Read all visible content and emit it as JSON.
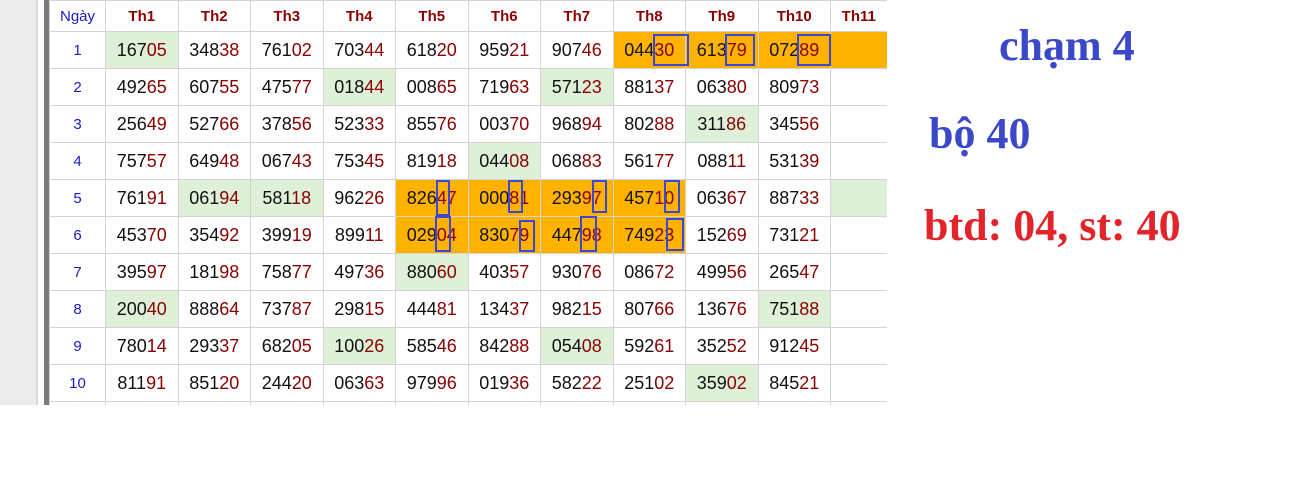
{
  "table": {
    "columns": [
      "Ngày",
      "Th1",
      "Th2",
      "Th3",
      "Th4",
      "Th5",
      "Th6",
      "Th7",
      "Th8",
      "Th9",
      "Th10",
      "Th11"
    ],
    "rows": [
      {
        "day": "1",
        "cells": [
          [
            "167",
            "05"
          ],
          [
            "348",
            "38"
          ],
          [
            "761",
            "02"
          ],
          [
            "703",
            "44"
          ],
          [
            "618",
            "20"
          ],
          [
            "959",
            "21"
          ],
          [
            "907",
            "46"
          ],
          [
            "044",
            "30"
          ],
          [
            "613",
            "79"
          ],
          [
            "072",
            "89"
          ],
          [
            "",
            ""
          ]
        ]
      },
      {
        "day": "2",
        "cells": [
          [
            "492",
            "65"
          ],
          [
            "607",
            "55"
          ],
          [
            "475",
            "77"
          ],
          [
            "018",
            "44"
          ],
          [
            "008",
            "65"
          ],
          [
            "719",
            "63"
          ],
          [
            "571",
            "23"
          ],
          [
            "881",
            "37"
          ],
          [
            "063",
            "80"
          ],
          [
            "809",
            "73"
          ],
          [
            "",
            ""
          ]
        ]
      },
      {
        "day": "3",
        "cells": [
          [
            "256",
            "49"
          ],
          [
            "527",
            "66"
          ],
          [
            "378",
            "56"
          ],
          [
            "523",
            "33"
          ],
          [
            "855",
            "76"
          ],
          [
            "003",
            "70"
          ],
          [
            "968",
            "94"
          ],
          [
            "802",
            "88"
          ],
          [
            "311",
            "86"
          ],
          [
            "345",
            "56"
          ],
          [
            "",
            ""
          ]
        ]
      },
      {
        "day": "4",
        "cells": [
          [
            "757",
            "57"
          ],
          [
            "649",
            "48"
          ],
          [
            "067",
            "43"
          ],
          [
            "753",
            "45"
          ],
          [
            "819",
            "18"
          ],
          [
            "044",
            "08"
          ],
          [
            "068",
            "83"
          ],
          [
            "561",
            "77"
          ],
          [
            "088",
            "11"
          ],
          [
            "531",
            "39"
          ],
          [
            "",
            ""
          ]
        ]
      },
      {
        "day": "5",
        "cells": [
          [
            "761",
            "91"
          ],
          [
            "061",
            "94"
          ],
          [
            "581",
            "18"
          ],
          [
            "962",
            "26"
          ],
          [
            "826",
            "47"
          ],
          [
            "000",
            "81"
          ],
          [
            "293",
            "97"
          ],
          [
            "457",
            "10"
          ],
          [
            "063",
            "67"
          ],
          [
            "887",
            "33"
          ],
          [
            "",
            ""
          ]
        ]
      },
      {
        "day": "6",
        "cells": [
          [
            "453",
            "70"
          ],
          [
            "354",
            "92"
          ],
          [
            "399",
            "19"
          ],
          [
            "899",
            "11"
          ],
          [
            "029",
            "04"
          ],
          [
            "830",
            "79"
          ],
          [
            "447",
            "98"
          ],
          [
            "749",
            "23"
          ],
          [
            "152",
            "69"
          ],
          [
            "731",
            "21"
          ],
          [
            "",
            ""
          ]
        ]
      },
      {
        "day": "7",
        "cells": [
          [
            "395",
            "97"
          ],
          [
            "181",
            "98"
          ],
          [
            "758",
            "77"
          ],
          [
            "497",
            "36"
          ],
          [
            "880",
            "60"
          ],
          [
            "403",
            "57"
          ],
          [
            "930",
            "76"
          ],
          [
            "086",
            "72"
          ],
          [
            "499",
            "56"
          ],
          [
            "265",
            "47"
          ],
          [
            "",
            ""
          ]
        ]
      },
      {
        "day": "8",
        "cells": [
          [
            "200",
            "40"
          ],
          [
            "888",
            "64"
          ],
          [
            "737",
            "87"
          ],
          [
            "298",
            "15"
          ],
          [
            "444",
            "81"
          ],
          [
            "134",
            "37"
          ],
          [
            "982",
            "15"
          ],
          [
            "807",
            "66"
          ],
          [
            "136",
            "76"
          ],
          [
            "751",
            "88"
          ],
          [
            "",
            ""
          ]
        ]
      },
      {
        "day": "9",
        "cells": [
          [
            "780",
            "14"
          ],
          [
            "293",
            "37"
          ],
          [
            "682",
            "05"
          ],
          [
            "100",
            "26"
          ],
          [
            "585",
            "46"
          ],
          [
            "842",
            "88"
          ],
          [
            "054",
            "08"
          ],
          [
            "592",
            "61"
          ],
          [
            "352",
            "52"
          ],
          [
            "912",
            "45"
          ],
          [
            "",
            ""
          ]
        ]
      },
      {
        "day": "10",
        "cells": [
          [
            "811",
            "91"
          ],
          [
            "851",
            "20"
          ],
          [
            "244",
            "20"
          ],
          [
            "063",
            "63"
          ],
          [
            "979",
            "96"
          ],
          [
            "019",
            "36"
          ],
          [
            "582",
            "22"
          ],
          [
            "251",
            "02"
          ],
          [
            "359",
            "02"
          ],
          [
            "845",
            "21"
          ],
          [
            "",
            ""
          ]
        ]
      }
    ],
    "green_cells": [
      [
        0,
        0
      ],
      [
        1,
        3
      ],
      [
        1,
        6
      ],
      [
        2,
        8
      ],
      [
        3,
        5
      ],
      [
        4,
        1
      ],
      [
        4,
        2
      ],
      [
        4,
        10
      ],
      [
        6,
        4
      ],
      [
        7,
        0
      ],
      [
        7,
        9
      ],
      [
        8,
        3
      ],
      [
        8,
        6
      ],
      [
        9,
        8
      ]
    ],
    "orange_cells": [
      [
        0,
        7
      ],
      [
        0,
        8
      ],
      [
        0,
        9
      ],
      [
        0,
        10
      ],
      [
        4,
        4
      ],
      [
        4,
        5
      ],
      [
        4,
        6
      ],
      [
        4,
        7
      ],
      [
        5,
        4
      ],
      [
        5,
        5
      ],
      [
        5,
        6
      ],
      [
        5,
        7
      ]
    ],
    "colors": {
      "green": "#dff0d8",
      "orange": "#ffb300",
      "box": "#3b48d6",
      "tail": "#8b0000",
      "header": "#8b0000",
      "day": "#1a1ac8"
    }
  },
  "notes": {
    "line1": "chạm 4",
    "line2": "bộ 40",
    "line3": "btd: 04, st: 40",
    "color_blue": "#3b48c9",
    "color_red": "#e3242b"
  }
}
